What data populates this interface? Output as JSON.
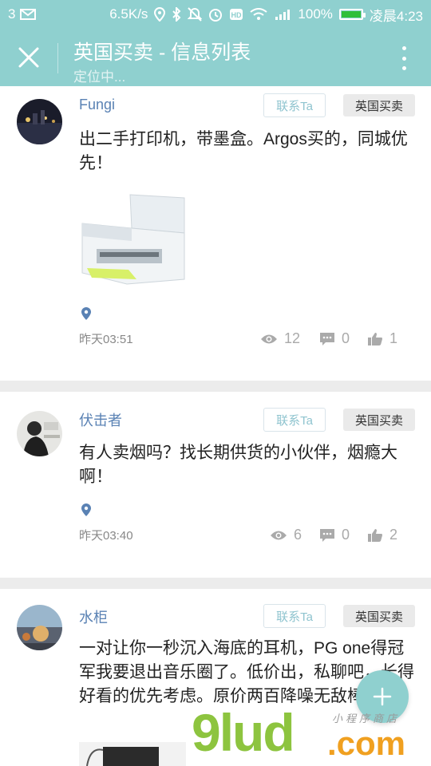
{
  "status_bar": {
    "sim": "3",
    "speed": "6.5K/s",
    "battery": "100%",
    "time": "凌晨4:23"
  },
  "app_bar": {
    "title": "英国买卖 - 信息列表",
    "subtitle": "定位中..."
  },
  "posts": [
    {
      "username": "Fungi",
      "contact_label": "联系Ta",
      "tag": "英国买卖",
      "content": "出二手打印机，带墨盒。Argos买的，同城优先！",
      "time": "昨天03:51",
      "views": "12",
      "comments": "0",
      "likes": "1"
    },
    {
      "username": "伏击者",
      "contact_label": "联系Ta",
      "tag": "英国买卖",
      "content": "有人卖烟吗？找长期供货的小伙伴，烟瘾大啊！",
      "time": "昨天03:40",
      "views": "6",
      "comments": "0",
      "likes": "2"
    },
    {
      "username": "水柜",
      "contact_label": "联系Ta",
      "tag": "英国买卖",
      "content": "一对让你一秒沉入海底的耳机，PG one得冠军我要退出音乐圈了。低价出，私聊吧，长得好看的优先考虑。原价两百降噪无敌棒！"
    }
  ],
  "watermark": {
    "main": "9lud",
    "domain": ".com",
    "tagline": "小程序商店"
  },
  "colors": {
    "accent": "#8fd0cf",
    "username": "#5a82b4",
    "tag_bg": "#eaeaea"
  }
}
